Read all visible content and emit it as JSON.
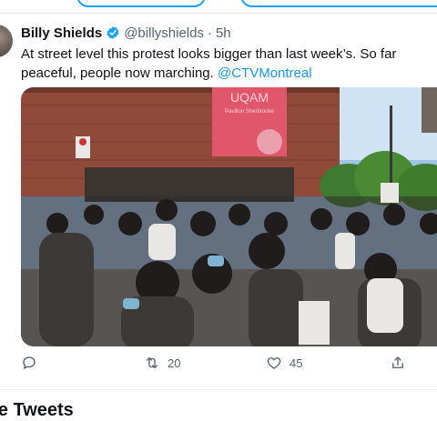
{
  "tweet": {
    "author_name": "Billy Shields",
    "handle": "@billyshields",
    "separator": "·",
    "time": "5h",
    "text_line1": "At street level this protest looks bigger than last week’s. So far",
    "text_line2": "peaceful, people now marching. ",
    "mention": "@CTVMontreal",
    "media": {
      "building_sign": "UQAM",
      "building_subsign": "Pavillon Sherbrooke"
    },
    "actions": {
      "reply_count": "",
      "retweet_count": "20",
      "like_count": "45"
    }
  },
  "section": {
    "heading": "re Tweets"
  },
  "colors": {
    "accent": "#1da1f2",
    "mention": "#1b95e0",
    "text": "#0f1419",
    "muted": "#536471"
  }
}
